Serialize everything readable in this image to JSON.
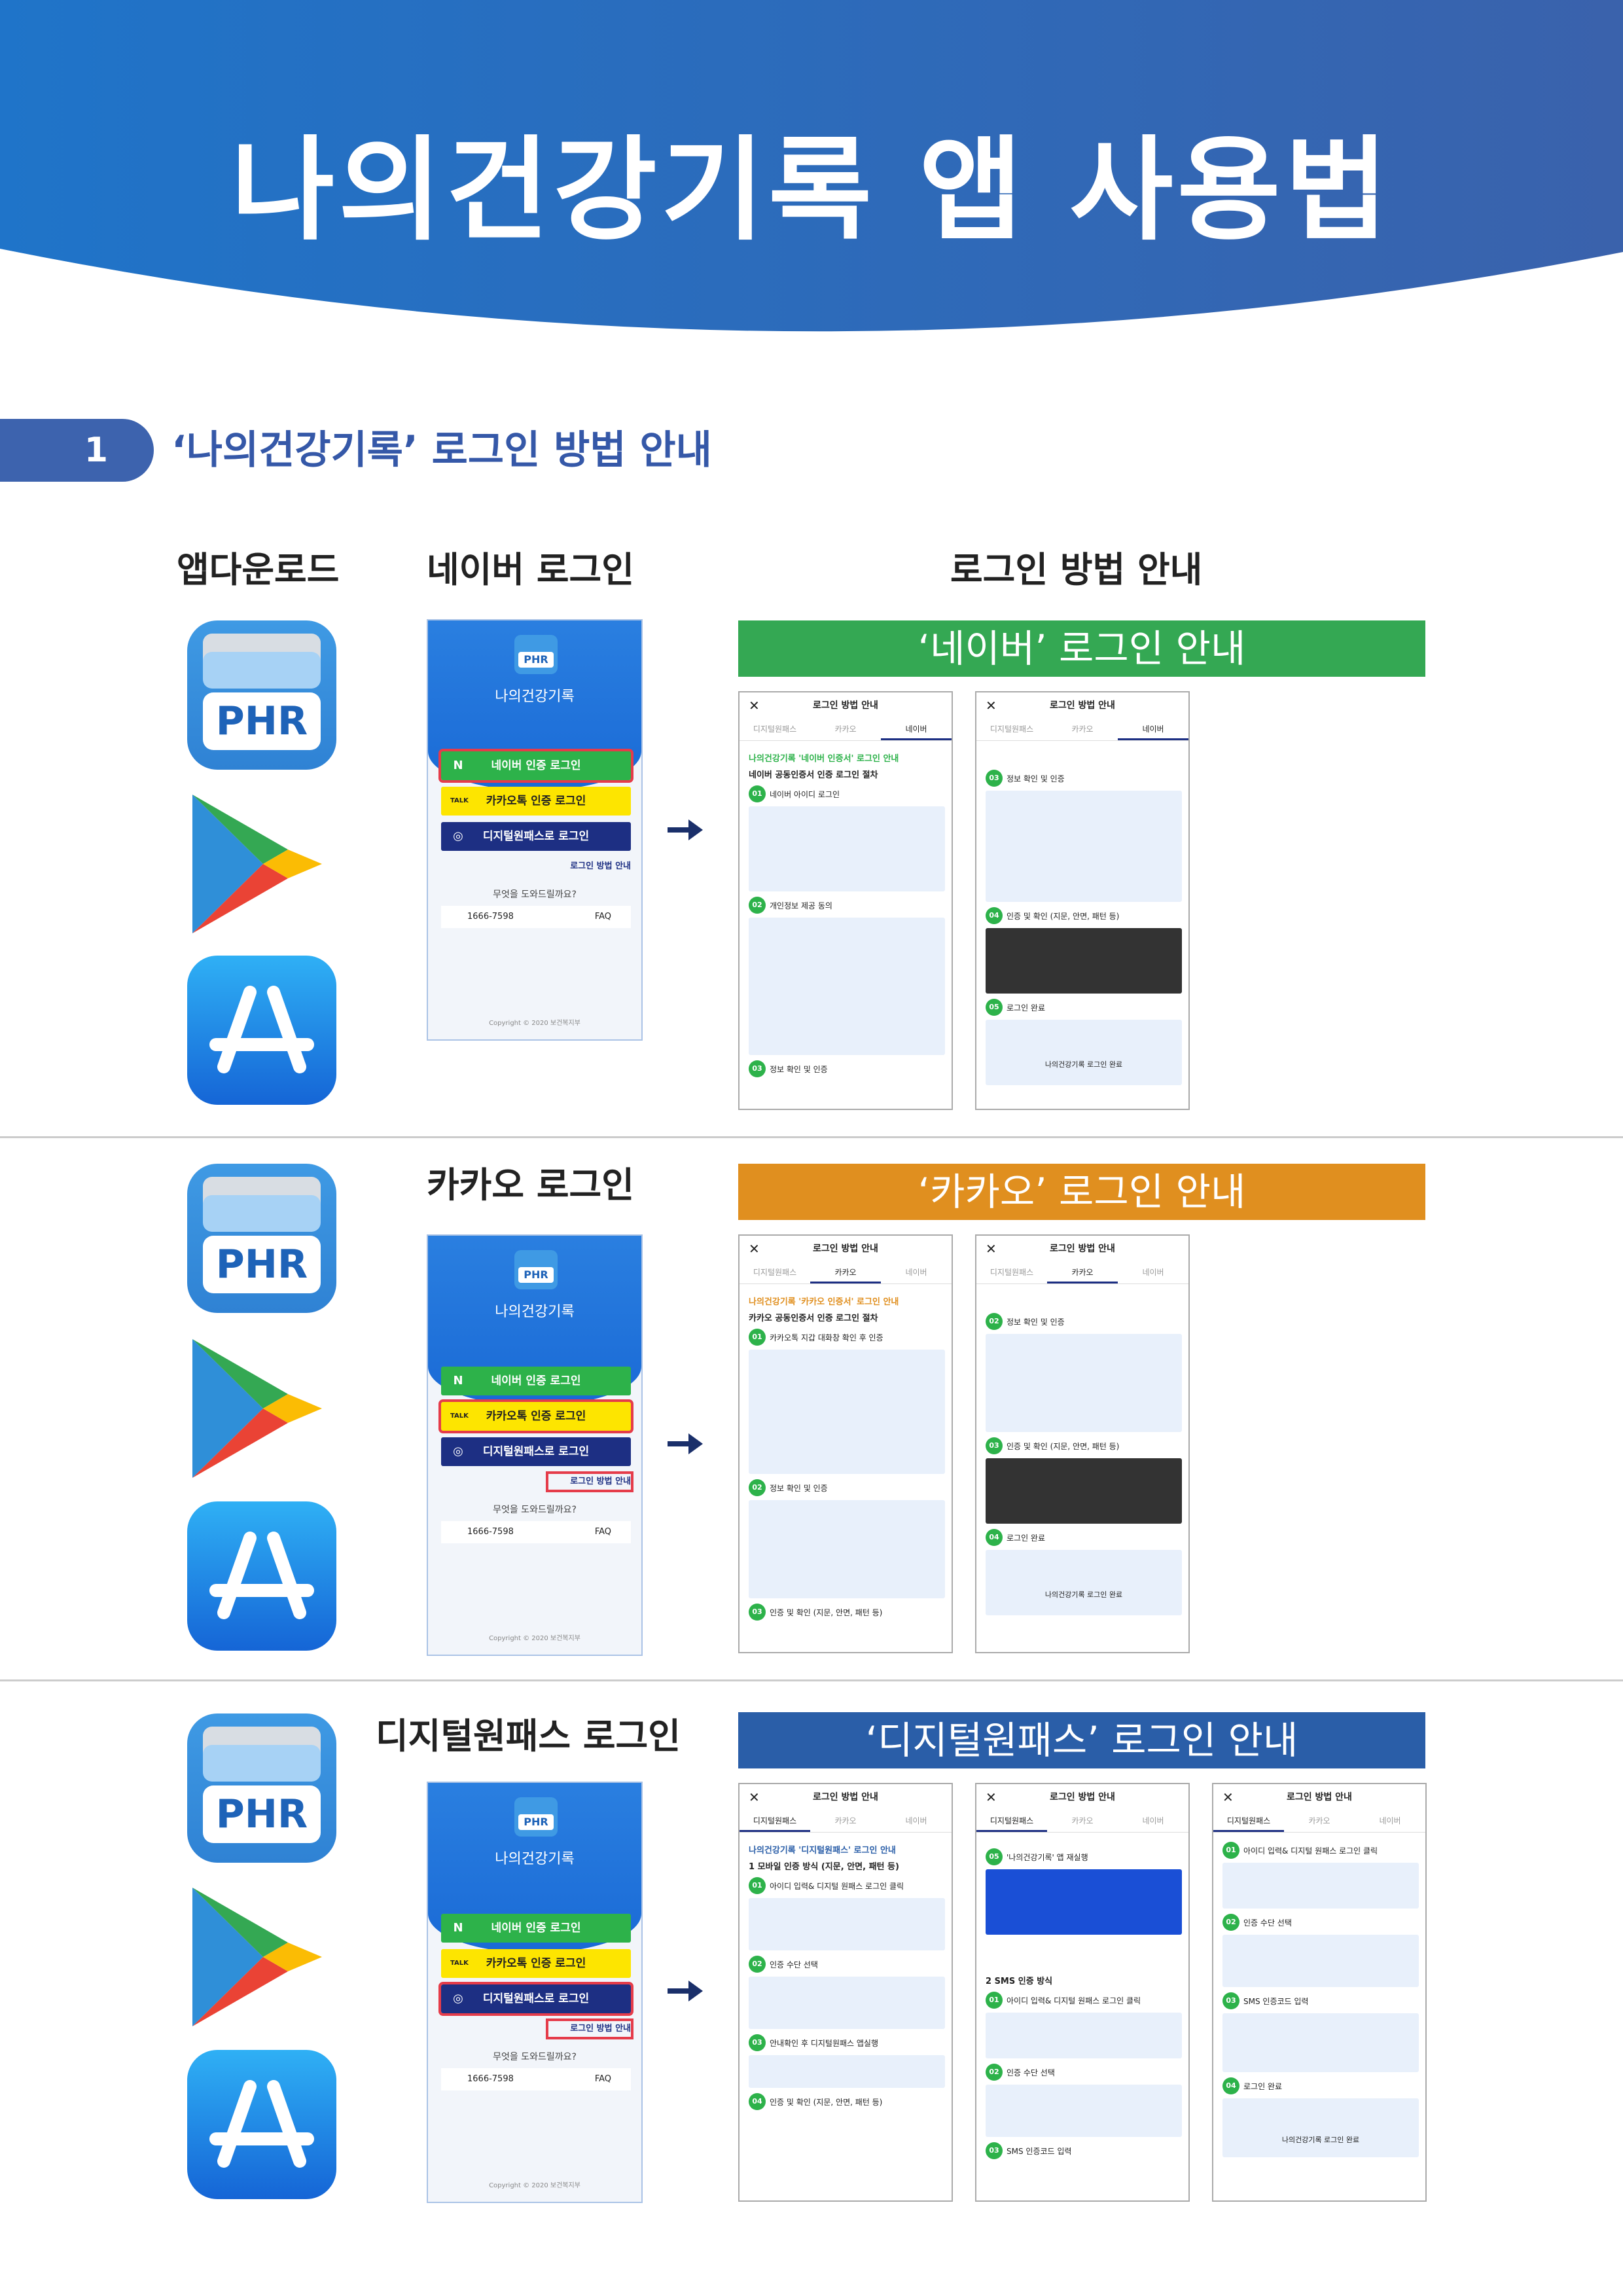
{
  "page": {
    "title": "나의건강기록 앱 사용법"
  },
  "section": {
    "number": "1",
    "title": "‘나의건강기록’ 로그인 방법 안내"
  },
  "columns": {
    "download": "앱다운로드",
    "naver_login": "네이버 로그인",
    "guide": "로그인 방법 안내"
  },
  "rows": [
    {
      "login_title": "네이버 로그인",
      "banner": "‘네이버’ 로그인 안내",
      "banner_color": "#34a853"
    },
    {
      "login_title": "카카오 로그인",
      "banner": "‘카카오’ 로그인 안내",
      "banner_color": "#e08f1f"
    },
    {
      "login_title": "디지털원패스 로그인",
      "banner": "‘디지털원패스’ 로그인 안내",
      "banner_color": "#2a5ea8"
    }
  ],
  "phone": {
    "app_name": "나의건강기록",
    "logo": "PHR",
    "naver_btn": "네이버 인증 로그인",
    "kakao_btn": "카카오톡 인증 로그인",
    "dp_btn": "디지털원패스로 로그인",
    "how_link": "로그인 방법 안내",
    "help_q": "무엇을 도와드릴까요?",
    "phone_no": "1666-7598",
    "faq": "FAQ",
    "copyright": "Copyright © 2020 보건복지부"
  },
  "guide": {
    "header": "로그인 방법 안내",
    "tabs": [
      "디지털원패스",
      "카카오",
      "네이버"
    ],
    "naver_title": "나의건강기록 '네이버 인증서' 로그인 안내",
    "naver_sub": "네이버 공동인증서 인증 로그인 절차",
    "naver_steps": [
      "네이버 아이디 로그인",
      "개인정보 제공 동의",
      "정보 확인 및 인증",
      "인증 및 확인 (지문, 안면, 패턴 등)",
      "로그인 완료"
    ],
    "kakao_title": "나의건강기록 '카카오 인증서' 로그인 안내",
    "kakao_sub": "카카오 공동인증서 인증 로그인 절차",
    "kakao_steps": [
      "카카오톡 지갑 대화창 확인 후 인증",
      "정보 확인 및 인증",
      "인증 및 확인 (지문, 안면, 패턴 등)",
      "로그인 완료"
    ],
    "dp_title": "나의건강기록 '디지털원패스' 로그인 안내",
    "dp_sub": "1 모바일 인증 방식 (지문, 안면, 패턴 등)",
    "dp_steps": [
      "아이디 입력& 디지털 원패스 로그인 클릭",
      "인증 수단 선택",
      "안내확인 후 디지털원패스 앱실행",
      "인증 및 확인 (지문, 안면, 패턴 등)",
      "'나의건강기록' 앱 재실행"
    ],
    "dp_sms": "2 SMS 인증 방식",
    "dp_sms_steps": [
      "아이디 입력& 디지털 원패스 로그인 클릭",
      "인증 수단 선택",
      "SMS 인증코드 입력",
      "로그인 완료"
    ],
    "done": "나의건강기록 로그인 완료"
  }
}
